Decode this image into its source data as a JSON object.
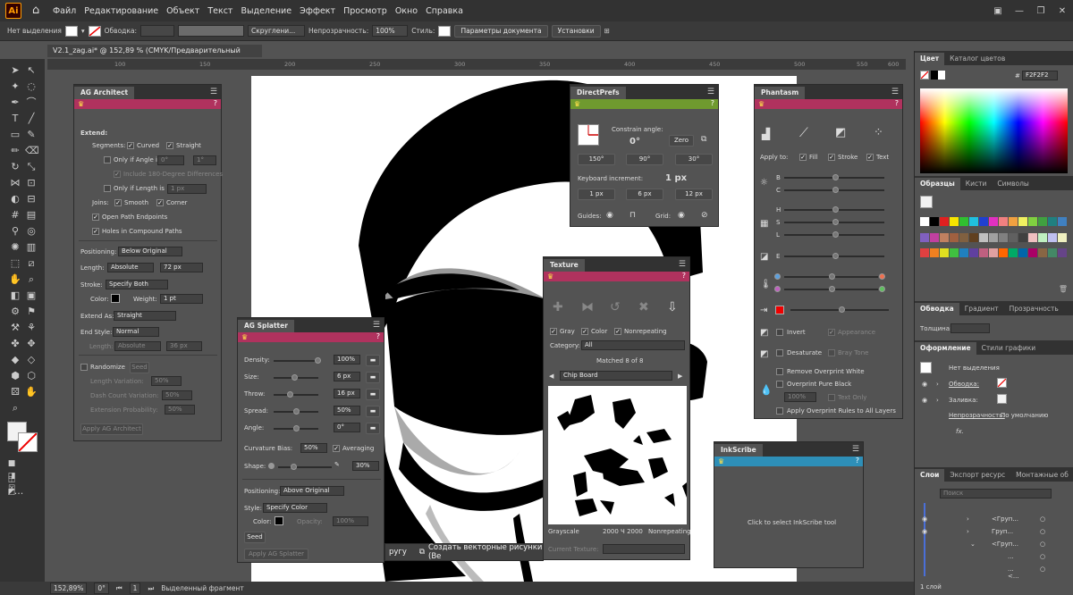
{
  "app": {
    "logo": "Ai",
    "menu": [
      "Файл",
      "Редактирование",
      "Объект",
      "Текст",
      "Выделение",
      "Эффект",
      "Просмотр",
      "Окно",
      "Справка"
    ]
  },
  "control_bar": {
    "selection": "Нет выделения",
    "stroke_label": "Обводка:",
    "brush": "Скруглени...",
    "opacity_label": "Непрозрачность:",
    "opacity_value": "100%",
    "style_label": "Стиль:",
    "doc_settings": "Параметры документа",
    "preferences": "Установки"
  },
  "document": {
    "tab_title": "V2.1_zag.ai* @ 152,89 % (CMYK/Предварительный просмотр)",
    "ruler_ticks": [
      "100",
      "150",
      "200",
      "250",
      "300",
      "350",
      "400",
      "450",
      "500",
      "550",
      "600"
    ]
  },
  "ag_architect": {
    "title": "AG Architect",
    "extend": "Extend:",
    "segments": "Segments:",
    "curved": "Curved",
    "straight": "Straight",
    "only_angle": "Only if Angle is",
    "angle_from": "0°",
    "angle_to": "1°",
    "include_180": "Include 180-Degree Differences",
    "only_length": "Only if Length is",
    "length_val": "1 px",
    "joins": "Joins:",
    "smooth": "Smooth",
    "corner": "Corner",
    "open_path": "Open Path Endpoints",
    "holes": "Holes in Compound Paths",
    "positioning": "Positioning:",
    "positioning_val": "Below Original",
    "length": "Length:",
    "length_mode": "Absolute",
    "length_px": "72 px",
    "stroke": "Stroke:",
    "stroke_val": "Specify Both",
    "color": "Color:",
    "weight": "Weight:",
    "weight_val": "1 pt",
    "extend_as": "Extend As:",
    "extend_as_val": "Straight",
    "end_style": "End Style:",
    "end_style_val": "Normal",
    "end_length": "Length:",
    "end_mode": "Absolute",
    "end_px": "36 px",
    "randomize": "Randomize",
    "seed": "Seed",
    "len_var": "Length Variation:",
    "len_var_val": "50%",
    "dash_var": "Dash Count Variation:",
    "dash_var_val": "50%",
    "ext_prob": "Extension Probability:",
    "ext_prob_val": "50%",
    "apply": "Apply AG Architect"
  },
  "ag_splatter": {
    "title": "AG Splatter",
    "rows": [
      {
        "label": "Density:",
        "value": "100%"
      },
      {
        "label": "Size:",
        "value": "6 px"
      },
      {
        "label": "Throw:",
        "value": "16 px"
      },
      {
        "label": "Spread:",
        "value": "50%"
      },
      {
        "label": "Angle:",
        "value": "0°"
      }
    ],
    "curvature": "Curvature Bias:",
    "curvature_val": "50%",
    "averaging": "Averaging",
    "shape": "Shape:",
    "shape_val": "30%",
    "positioning": "Positioning:",
    "positioning_val": "Above Original",
    "style": "Style:",
    "style_val": "Specify Color",
    "color": "Color:",
    "opacity": "Opacity:",
    "opacity_val": "100%",
    "seed": "Seed",
    "apply": "Apply AG Splatter"
  },
  "directprefs": {
    "title": "DirectPrefs",
    "constrain": "Constrain angle:",
    "angle": "0°",
    "zero": "Zero",
    "angles": [
      "150°",
      "90°",
      "30°"
    ],
    "keyboard": "Keyboard increment:",
    "increment": "1 px",
    "increments": [
      "1 px",
      "6 px",
      "12 px"
    ],
    "guides": "Guides:",
    "grid": "Grid:"
  },
  "phantasm": {
    "title": "Phantasm",
    "apply_to": "Apply to:",
    "fill": "Fill",
    "stroke": "Stroke",
    "text": "Text",
    "h": "H",
    "c": "C",
    "b": "B",
    "s": "S",
    "l": "L",
    "e": "E",
    "invert": "Invert",
    "appearance": "Appearance",
    "desaturate": "Desaturate",
    "bray_tone": "Bray Tone",
    "remove_overprint": "Remove Overprint White",
    "overprint_black": "Overprint Pure Black",
    "overprint_pct": "100%",
    "text_only": "Text Only",
    "apply_overprint": "Apply Overprint Rules to All Layers"
  },
  "texture": {
    "title": "Texture",
    "gray": "Gray",
    "color": "Color",
    "nonrepeating": "Nonrepeating",
    "category": "Category:",
    "category_val": "All",
    "matched": "Matched 8 of 8",
    "texture_name": "Chip Board",
    "footer_left": "Grayscale",
    "footer_mid": "2000 Ч 2000",
    "footer_right": "Nonrepeating",
    "current": "Current Texture:"
  },
  "inkscribe": {
    "title": "InkScribe",
    "hint": "Click to select InkScribe tool"
  },
  "taskbar": {
    "left": "ругу",
    "right": "Создать векторные рисунки (Ве"
  },
  "right_dock": {
    "color_tabs": [
      "Цвет",
      "Каталог цветов"
    ],
    "hex": "F2F2F2",
    "swatch_tabs": [
      "Образцы",
      "Кисти",
      "Символы"
    ],
    "stroke_tabs": [
      "Обводка",
      "Градиент",
      "Прозрачность"
    ],
    "weight_label": "Толщина:",
    "appearance_tabs": [
      "Оформление",
      "Стили графики"
    ],
    "no_selection": "Нет выделения",
    "stroke_row": "Обводка:",
    "fill_row": "Заливка:",
    "opacity_row": "Непрозрачность:",
    "opacity_default": "По умолчанию",
    "fx": "fx.",
    "layers_tabs": [
      "Слои",
      "Экспорт ресурс",
      "Монтажные об"
    ],
    "search": "Поиск",
    "layers": [
      "<Груп...",
      "Груп...",
      "<Груп...",
      "...",
      "...",
      "<..."
    ],
    "layer_count": "1 слой"
  },
  "status": {
    "zoom": "152,89%",
    "angle": "0°",
    "page": "1",
    "mode": "Выделенный фрагмент"
  },
  "colors": {
    "accent_magenta": "#b0325e",
    "accent_green": "#6f9a2f",
    "accent_blue": "#2e8fb8",
    "panel": "#535353",
    "dark": "#323232"
  }
}
